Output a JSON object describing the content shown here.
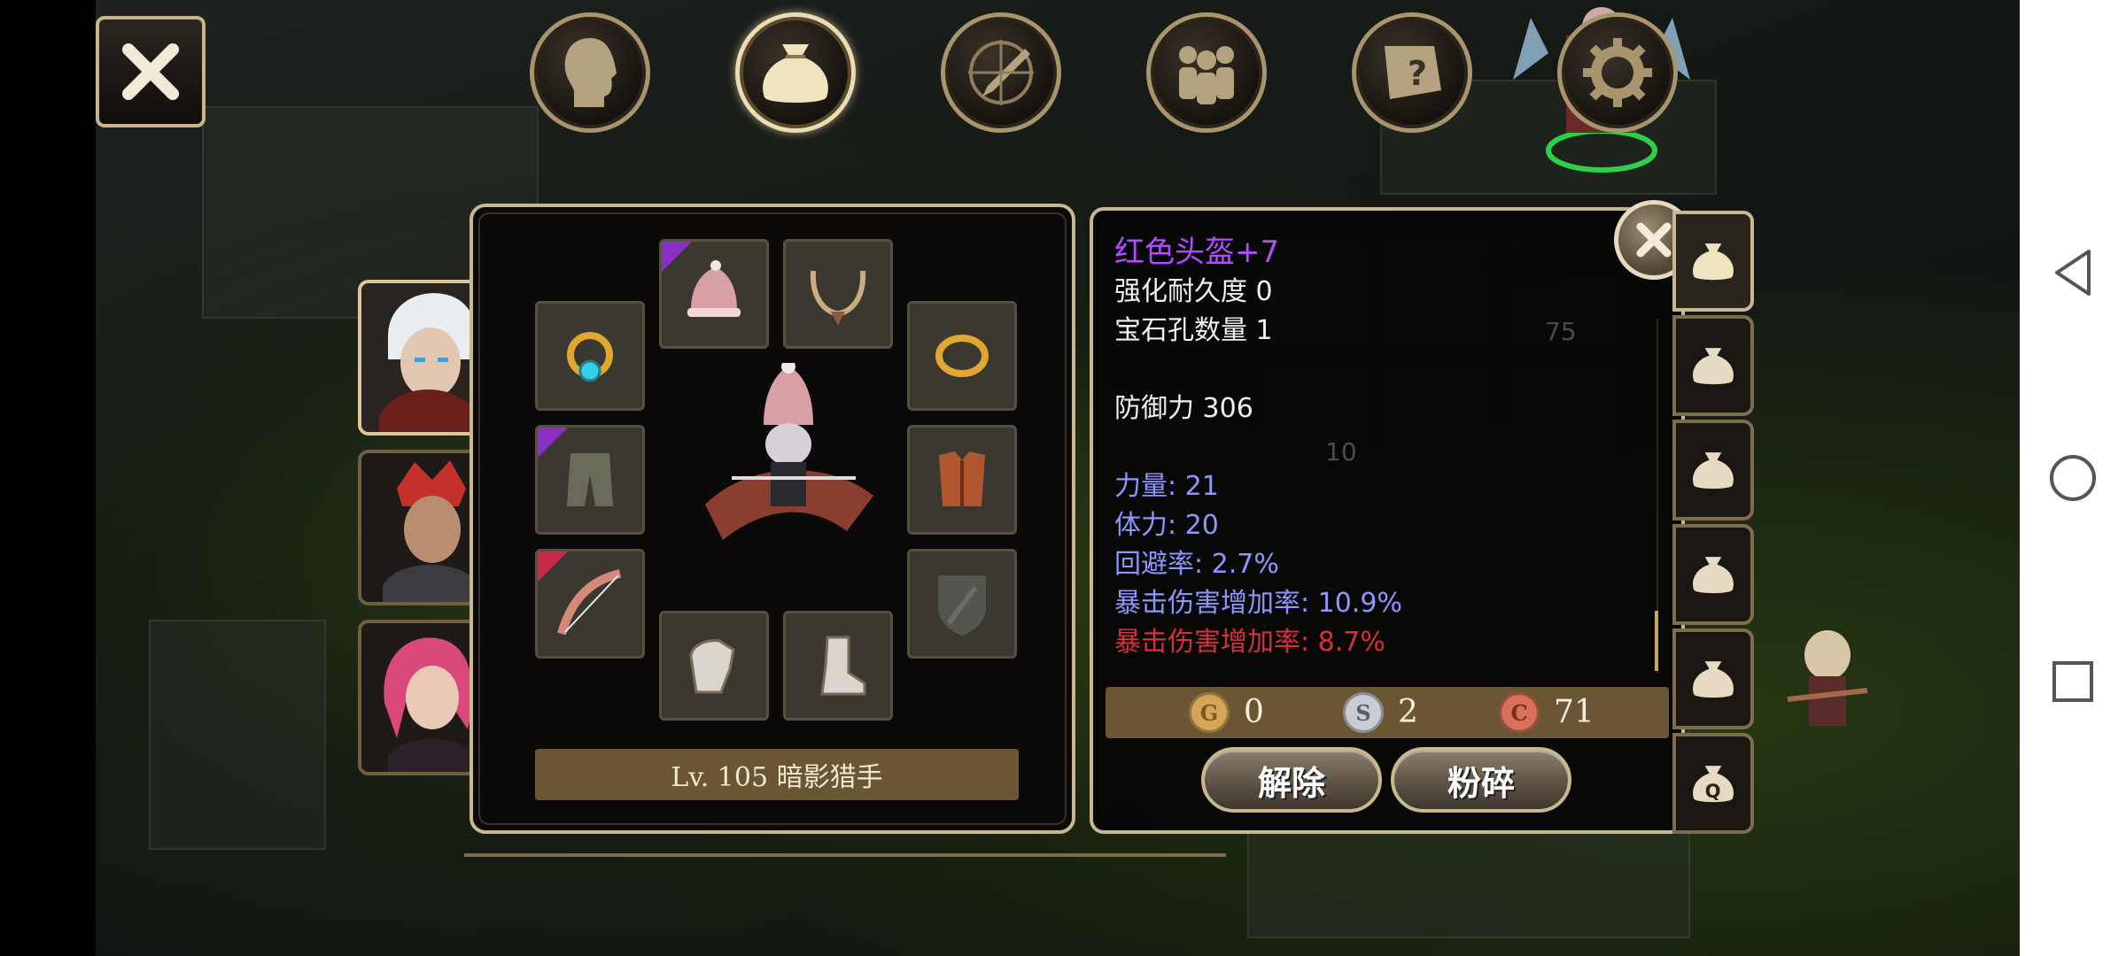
{
  "item": {
    "name": "红色头盔+7",
    "durability": "强化耐久度 0",
    "gem_slots": "宝石孔数量 1",
    "defense": "防御力 306",
    "stats": [
      {
        "text": "力量: 21",
        "color": "#8e95ff"
      },
      {
        "text": "体力: 20",
        "color": "#8e95ff"
      },
      {
        "text": "回避率: 2.7%",
        "color": "#8e95ff"
      },
      {
        "text": "暴击伤害增加率: 10.9%",
        "color": "#8e95ff"
      },
      {
        "text": "暴击伤害增加率: 8.7%",
        "color": "#d6303a"
      }
    ]
  },
  "currency": {
    "gold_symbol": "G",
    "gold": "0",
    "silver_symbol": "S",
    "silver": "2",
    "copper_symbol": "C",
    "copper": "71"
  },
  "buttons": {
    "unequip": "解除",
    "shatter": "粉碎"
  },
  "character": {
    "level_class": "Lv. 105 暗影猎手"
  },
  "ghost_counts": {
    "a": "75",
    "b": "10"
  },
  "colors": {
    "rarity_purple": "#8b2fc9",
    "rarity_red": "#c8284a",
    "frame_gold": "#c9b78f"
  },
  "icons": {
    "tabs": [
      "head-icon",
      "bag-icon",
      "sword-compass-icon",
      "party-icon",
      "quest-scroll-icon",
      "settings-gear-icon"
    ],
    "nav": [
      "back-icon",
      "home-icon",
      "recents-icon"
    ]
  }
}
